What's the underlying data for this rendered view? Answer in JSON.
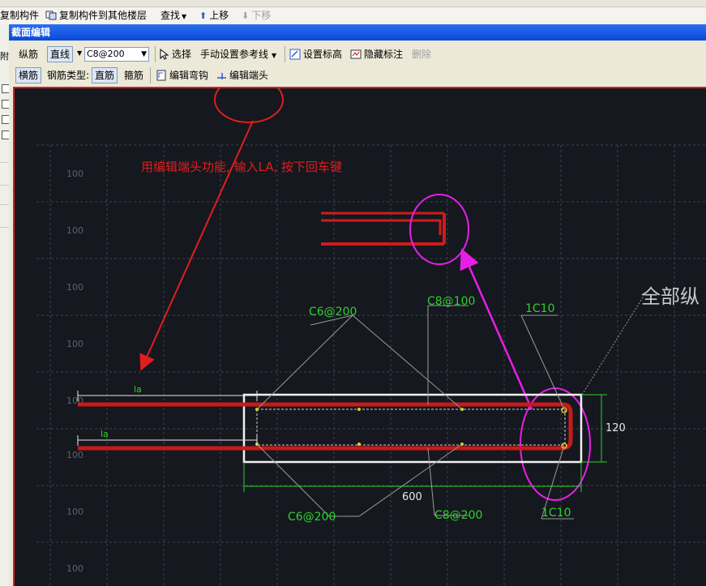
{
  "top_toolbar": {
    "copy_component": "复制构件",
    "copy_to_floor": "复制构件到其他楼层",
    "find": "查找",
    "move_up": "上移",
    "move_down": "下移"
  },
  "left_strip_label": "附",
  "dialog": {
    "title": "截面编辑",
    "row1": {
      "longitudinal": "纵筋",
      "line_mode": "直线",
      "rebar_spec": "C8@200",
      "select": "选择",
      "manual_ref": "手动设置参考线",
      "set_elevation": "设置标高",
      "hide_annot": "隐藏标注",
      "delete": "删除"
    },
    "row2": {
      "transverse": "横筋",
      "rebar_type_label": "钢筋类型:",
      "straight": "直筋",
      "stirrup": "箍筋",
      "edit_hook": "编辑弯钩",
      "edit_end": "编辑端头"
    }
  },
  "canvas": {
    "grid_labels": [
      "100",
      "100",
      "100",
      "100",
      "100",
      "100",
      "100",
      "100",
      "100"
    ],
    "instruction": "用编辑端头功能, 输入LA, 按下回车键",
    "partial_label": "全部纵",
    "labels": {
      "c6_top": "C6@200",
      "c8_top": "C8@100",
      "c10_top": "1C10",
      "c6_bot": "C6@200",
      "c8_bot": "C8@200",
      "c10_bot": "1C10",
      "la1": "la",
      "la2": "la",
      "dim_width": "600",
      "dim_height": "120"
    }
  },
  "colors": {
    "canvas_bg": "#15181e",
    "annotation_red": "#e01e1e",
    "annotation_magenta": "#e81ee8",
    "label_green": "#2fd12f",
    "rebar_red": "#c81a1a"
  }
}
